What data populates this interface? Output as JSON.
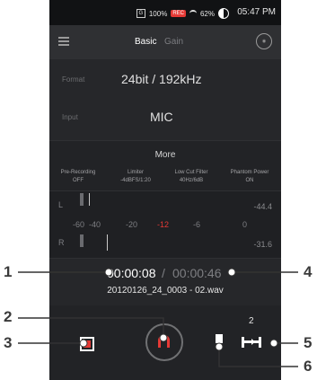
{
  "status": {
    "signal": "G",
    "battery_percent": "100%",
    "rec_badge": "REC",
    "wifi_percent": "62%",
    "time": "05:47 PM"
  },
  "topbar": {
    "tabs": [
      "Basic",
      "Gain"
    ],
    "aux_icon": "dial-icon"
  },
  "settings": {
    "format": {
      "label": "Format",
      "value": "24bit / 192kHz"
    },
    "input": {
      "label": "Input",
      "value": "MIC"
    }
  },
  "more": {
    "title": "More",
    "options": [
      {
        "label": "Pre-Recording",
        "value": "OFF"
      },
      {
        "label": "Limiter",
        "value": "-4dBFS/1:20"
      },
      {
        "label": "Low Cut Filter",
        "value": "40Hz/6dB"
      },
      {
        "label": "Phantom Power",
        "value": "ON"
      }
    ]
  },
  "meter": {
    "left_label": "L",
    "right_label": "R",
    "scale": [
      "-60",
      "-40",
      "-20",
      "-12",
      "-6",
      "0"
    ],
    "peak_left": "-44.4",
    "peak_right": "-31.6",
    "colors": {
      "warning": "#e53935"
    }
  },
  "timer": {
    "elapsed": "00:00:08",
    "separator": "/",
    "total": "00:00:46",
    "filename": "20120126_24_0003 - 02.wav"
  },
  "controls": {
    "loop_count": "2"
  },
  "callouts": [
    "1",
    "2",
    "3",
    "4",
    "5",
    "6"
  ]
}
